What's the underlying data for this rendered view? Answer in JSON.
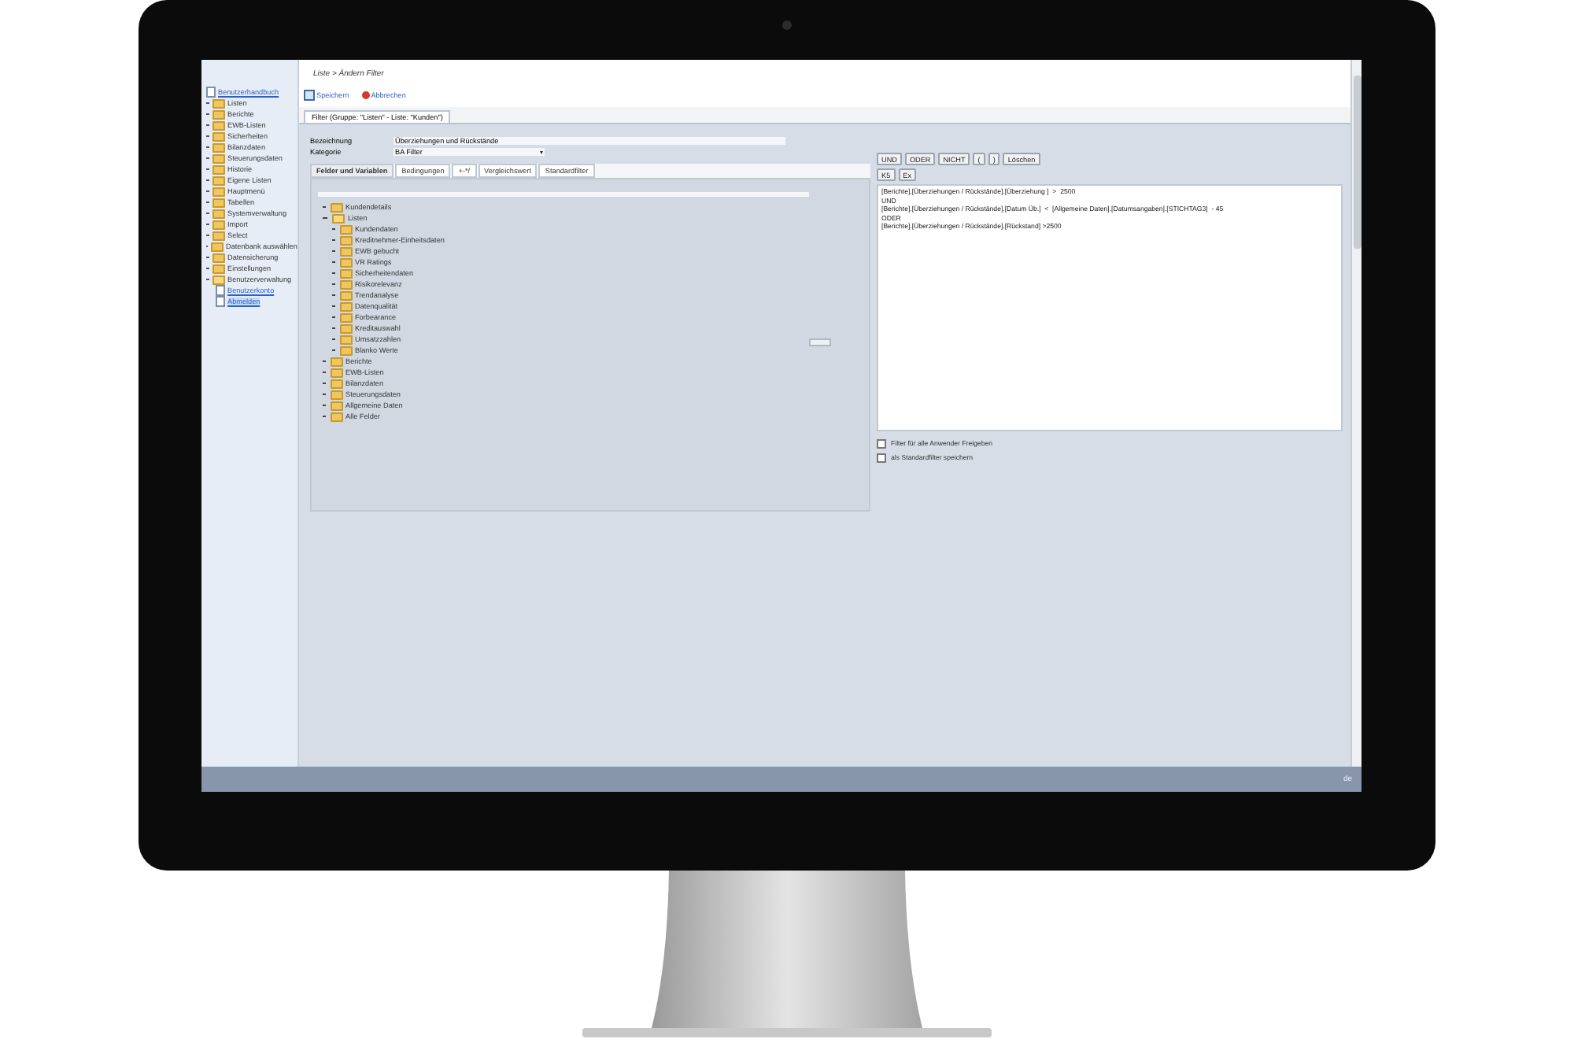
{
  "sidebar": {
    "items": [
      {
        "label": "Benutzerhandbuch",
        "kind": "link",
        "selected": false
      },
      {
        "label": "Listen",
        "kind": "folder",
        "expanded": false
      },
      {
        "label": "Berichte",
        "kind": "folder",
        "expanded": false
      },
      {
        "label": "EWB-Listen",
        "kind": "folder",
        "expanded": false
      },
      {
        "label": "Sicherheiten",
        "kind": "folder",
        "expanded": false
      },
      {
        "label": "Bilanzdaten",
        "kind": "folder",
        "expanded": false
      },
      {
        "label": "Steuerungsdaten",
        "kind": "folder",
        "expanded": false
      },
      {
        "label": "Historie",
        "kind": "folder",
        "expanded": false
      },
      {
        "label": "Eigene Listen",
        "kind": "folder",
        "expanded": false
      },
      {
        "label": "Hauptmenü",
        "kind": "folder",
        "expanded": false
      },
      {
        "label": "Tabellen",
        "kind": "folder",
        "expanded": false
      },
      {
        "label": "Systemverwaltung",
        "kind": "folder",
        "expanded": false
      },
      {
        "label": "Import",
        "kind": "folder",
        "expanded": false
      },
      {
        "label": "Select",
        "kind": "folder",
        "expanded": false
      },
      {
        "label": "Datenbank auswählen",
        "kind": "folder",
        "expanded": false
      },
      {
        "label": "Datensicherung",
        "kind": "folder",
        "expanded": false
      },
      {
        "label": "Einstellungen",
        "kind": "folder",
        "expanded": false
      },
      {
        "label": "Benutzerverwaltung",
        "kind": "folder",
        "expanded": true,
        "children": [
          {
            "label": "Benutzerkonto",
            "selected": false
          },
          {
            "label": "Abmelden",
            "selected": true
          }
        ]
      }
    ]
  },
  "breadcrumb": "Liste > Ändern Filter",
  "toolbar": [
    {
      "label": "Speichern",
      "kind": "save"
    },
    {
      "label": "Abbrechen",
      "kind": "cancel"
    }
  ],
  "tab": "Filter (Gruppe: \"Listen\" - Liste: \"Kunden\")",
  "form": {
    "bezeichnung_label": "Bezeichnung",
    "bezeichnung": "Überziehungen und Rückstände",
    "kategorie_label": "Kategorie",
    "kategorie": "BA Filter"
  },
  "inner_tabs": [
    {
      "label": "Felder und Variablen",
      "selected": true
    },
    {
      "label": "Bedingungen",
      "selected": false
    },
    {
      "label": "+-*/",
      "selected": false
    },
    {
      "label": "Vergleichswert",
      "selected": false
    },
    {
      "label": "Standardfilter",
      "selected": false
    }
  ],
  "tree": [
    {
      "label": "Kundendetails",
      "expanded": false
    },
    {
      "label": "Listen",
      "expanded": true,
      "children": [
        {
          "label": "Kundendaten",
          "expanded": false
        },
        {
          "label": "Kreditnehmer-Einheitsdaten",
          "expanded": false
        },
        {
          "label": "EWB gebucht",
          "expanded": false
        },
        {
          "label": "VR Ratings",
          "expanded": false
        },
        {
          "label": "Sicherheitendaten",
          "expanded": false
        },
        {
          "label": "Risikorelevanz",
          "expanded": false
        },
        {
          "label": "Trendanalyse",
          "expanded": false
        },
        {
          "label": "Datenqualität",
          "expanded": false
        },
        {
          "label": "Forbearance",
          "expanded": false
        },
        {
          "label": "Kreditauswahl",
          "expanded": false
        },
        {
          "label": "Umsatzzahlen",
          "expanded": false
        },
        {
          "label": "Blanko Werte",
          "expanded": false
        }
      ]
    },
    {
      "label": "Berichte",
      "expanded": false
    },
    {
      "label": "EWB-Listen",
      "expanded": false
    },
    {
      "label": "Bilanzdaten",
      "expanded": false
    },
    {
      "label": "Steuerungsdaten",
      "expanded": false
    },
    {
      "label": "Allgemeine Daten",
      "expanded": false
    },
    {
      "label": "Alle Felder",
      "expanded": false
    }
  ],
  "operators": [
    "UND",
    "ODER",
    "NICHT",
    "(",
    ")",
    "Löschen"
  ],
  "small_buttons": [
    "K5",
    "Ex"
  ],
  "expression": [
    "[Berichte].[Überziehungen / Rückstände].[Überziehung ]  >  2500",
    "UND",
    "[Berichte].[Überziehungen / Rückstände].[Datum Üb.]  <  [Allgemeine Daten].[Datumsangaben].[STICHTAG3]  - 45",
    "ODER",
    "[Berichte].[Überziehungen / Rückstände].[Rückstand] >2500"
  ],
  "options": [
    {
      "label": "Filter für alle Anwender Freigeben",
      "checked": false
    },
    {
      "label": "als Standardfilter speichern",
      "checked": false
    }
  ],
  "status": "de"
}
